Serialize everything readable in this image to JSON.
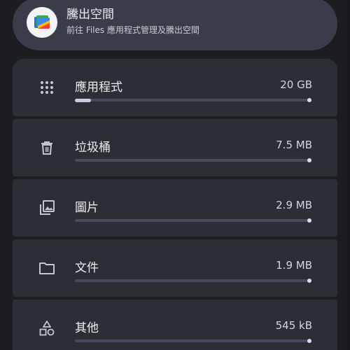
{
  "banner": {
    "title": "騰出空間",
    "subtitle": "前往 Files 應用程式管理及騰出空間",
    "icon": "files-app-icon"
  },
  "categories": [
    {
      "label": "應用程式",
      "size": "20 GB",
      "icon": "apps-grid-icon",
      "fill": 0.07
    },
    {
      "label": "垃圾桶",
      "size": "7.5 MB",
      "icon": "trash-icon",
      "fill": 0.0
    },
    {
      "label": "圖片",
      "size": "2.9 MB",
      "icon": "image-icon",
      "fill": 0.0
    },
    {
      "label": "文件",
      "size": "1.9 MB",
      "icon": "folder-icon",
      "fill": 0.0
    },
    {
      "label": "其他",
      "size": "545 kB",
      "icon": "shapes-icon",
      "fill": 0.0
    }
  ],
  "colors": {
    "background": "#1c1d21",
    "card": "#2c2e36",
    "banner": "#3a3d49",
    "bar_track": "#464a5c",
    "bar_fill": "#c8cce8"
  }
}
